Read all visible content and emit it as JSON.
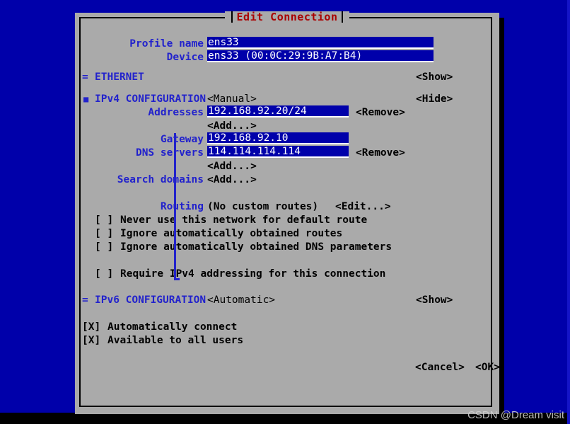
{
  "window": {
    "title": "Edit Connection"
  },
  "header": {
    "profile_name_label": "Profile name",
    "profile_name_value": "ens33",
    "device_label": "Device",
    "device_value": "ens33 (00:0C:29:9B:A7:B4)"
  },
  "ethernet": {
    "marker": "=",
    "label": "ETHERNET",
    "toggle": "<Show>"
  },
  "ipv4": {
    "marker": "■",
    "label": "IPv4 CONFIGURATION",
    "method": "<Manual>",
    "toggle": "<Hide>",
    "addresses_label": "Addresses",
    "addresses_value": "192.168.92.20/24",
    "addresses_remove": "<Remove>",
    "addresses_add": "<Add...>",
    "gateway_label": "Gateway",
    "gateway_value": "192.168.92.10",
    "dns_label": "DNS servers",
    "dns_value": "114.114.114.114",
    "dns_remove": "<Remove>",
    "dns_add": "<Add...>",
    "search_domains_label": "Search domains",
    "search_domains_add": "<Add...>",
    "routing_label": "Routing",
    "routing_value": "(No custom routes)",
    "routing_edit": "<Edit...>",
    "checkboxes": [
      {
        "box": "[ ]",
        "label": "Never use this network for default route",
        "checked": false
      },
      {
        "box": "[ ]",
        "label": "Ignore automatically obtained routes",
        "checked": false
      },
      {
        "box": "[ ]",
        "label": "Ignore automatically obtained DNS parameters",
        "checked": false
      },
      {
        "box": "[ ]",
        "label": "Require IPv4 addressing for this connection",
        "checked": false
      }
    ]
  },
  "ipv6": {
    "marker": "=",
    "label": "IPv6 CONFIGURATION",
    "method": "<Automatic>",
    "toggle": "<Show>"
  },
  "options": [
    {
      "box": "[X]",
      "label": "Automatically connect",
      "checked": true
    },
    {
      "box": "[X]",
      "label": "Available to all users",
      "checked": true
    }
  ],
  "buttons": {
    "cancel": "<Cancel>",
    "ok": "<OK>"
  },
  "watermark": "CSDN @Dream visit",
  "colors": {
    "terminal_background": "#0000aa",
    "dialog_background": "#aaaaaa",
    "label_blue": "#2222cc",
    "title_red": "#aa0000",
    "field_background": "#0000aa",
    "field_text": "#ffffff"
  }
}
